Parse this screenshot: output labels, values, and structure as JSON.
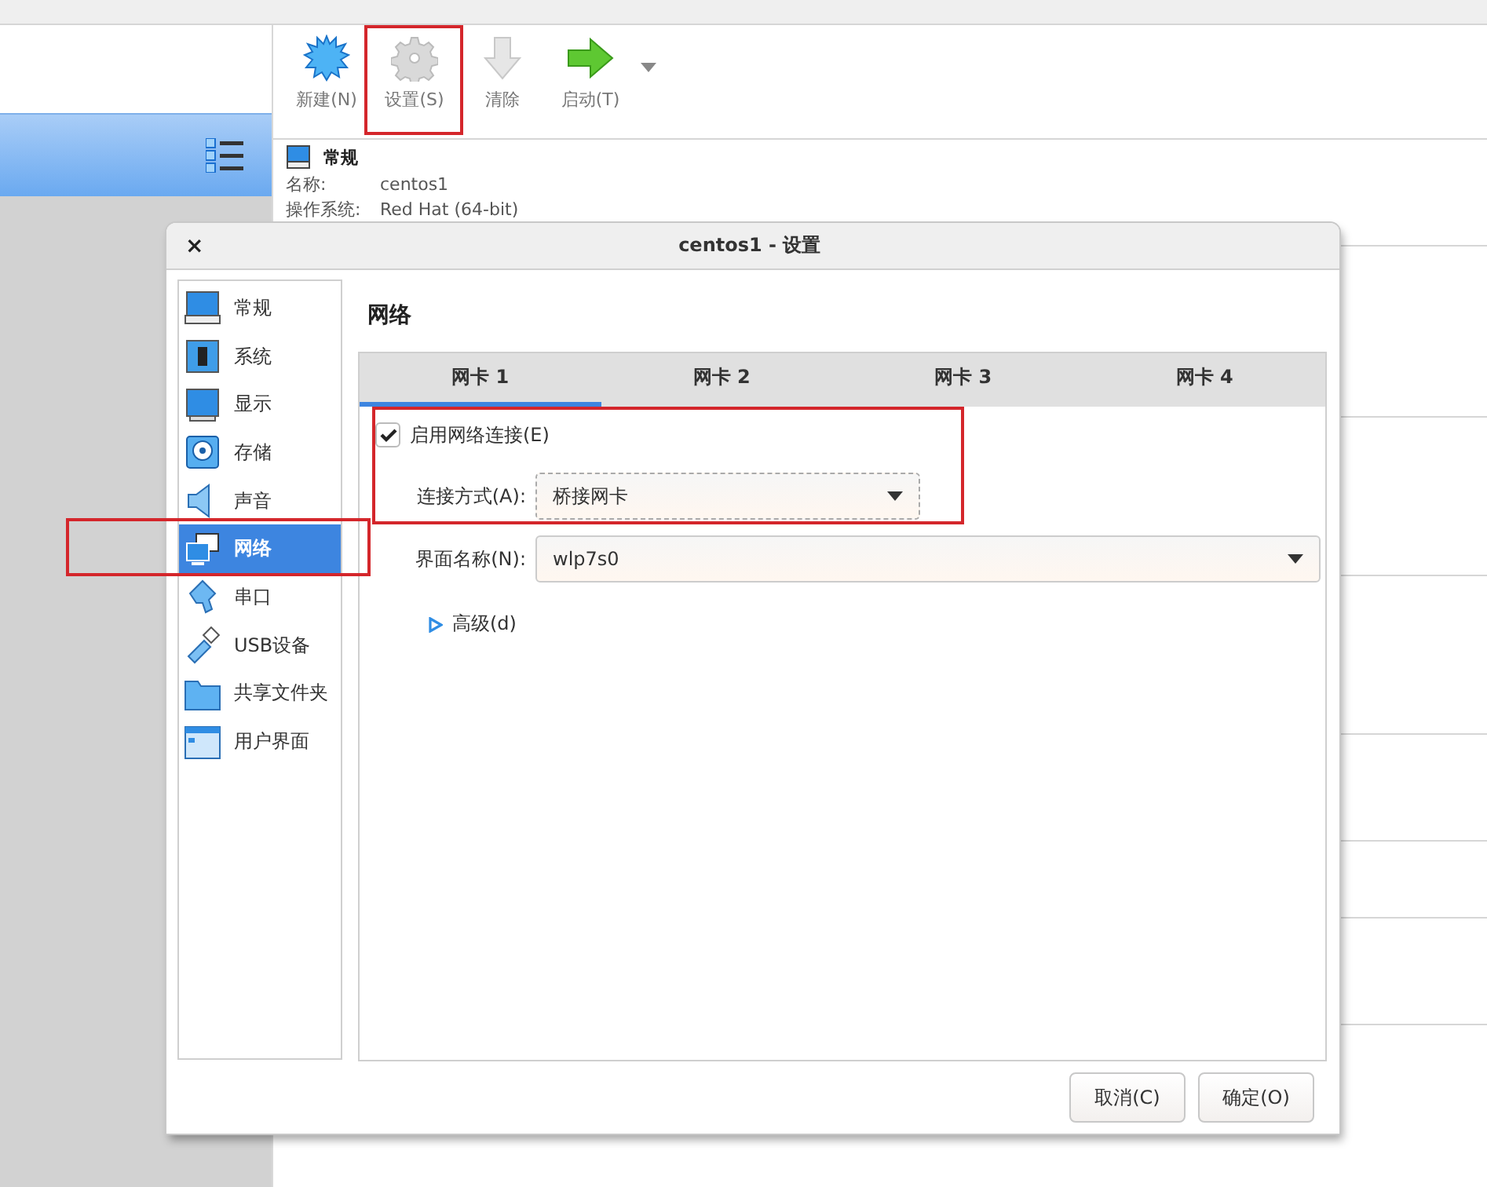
{
  "toolbar": {
    "buttons": [
      {
        "label": "新建(N)",
        "kind": "new"
      },
      {
        "label": "设置(S)",
        "kind": "settings"
      },
      {
        "label": "清除",
        "kind": "discard"
      },
      {
        "label": "启动(T)",
        "kind": "start"
      }
    ]
  },
  "details": {
    "section": "常规",
    "fields": [
      {
        "label": "名称:",
        "value": "centos1"
      },
      {
        "label": "操作系统:",
        "value": "Red Hat (64-bit)"
      }
    ]
  },
  "dialog": {
    "close": "×",
    "title": "centos1 - 设置",
    "nav": [
      {
        "label": "常规",
        "kind": "general",
        "selected": false
      },
      {
        "label": "系统",
        "kind": "system",
        "selected": false
      },
      {
        "label": "显示",
        "kind": "display",
        "selected": false
      },
      {
        "label": "存储",
        "kind": "storage",
        "selected": false
      },
      {
        "label": "声音",
        "kind": "audio",
        "selected": false
      },
      {
        "label": "网络",
        "kind": "network",
        "selected": true
      },
      {
        "label": "串口",
        "kind": "serial",
        "selected": false
      },
      {
        "label": "USB设备",
        "kind": "usb",
        "selected": false
      },
      {
        "label": "共享文件夹",
        "kind": "shared",
        "selected": false
      },
      {
        "label": "用户界面",
        "kind": "ui",
        "selected": false
      }
    ],
    "page_title": "网络",
    "tabs": [
      {
        "label": "网卡 1",
        "selected": true
      },
      {
        "label": "网卡 2",
        "selected": false
      },
      {
        "label": "网卡 3",
        "selected": false
      },
      {
        "label": "网卡 4",
        "selected": false
      }
    ],
    "enable_adapter": {
      "label": "启用网络连接(E)",
      "checked": true
    },
    "attached_to": {
      "label": "连接方式(A):",
      "value": "桥接网卡"
    },
    "interface_name": {
      "label": "界面名称(N):",
      "value": "wlp7s0"
    },
    "advanced": {
      "label": "高级(d)",
      "expanded": false
    },
    "buttons": [
      "取消(C)",
      "确定(O)"
    ]
  }
}
